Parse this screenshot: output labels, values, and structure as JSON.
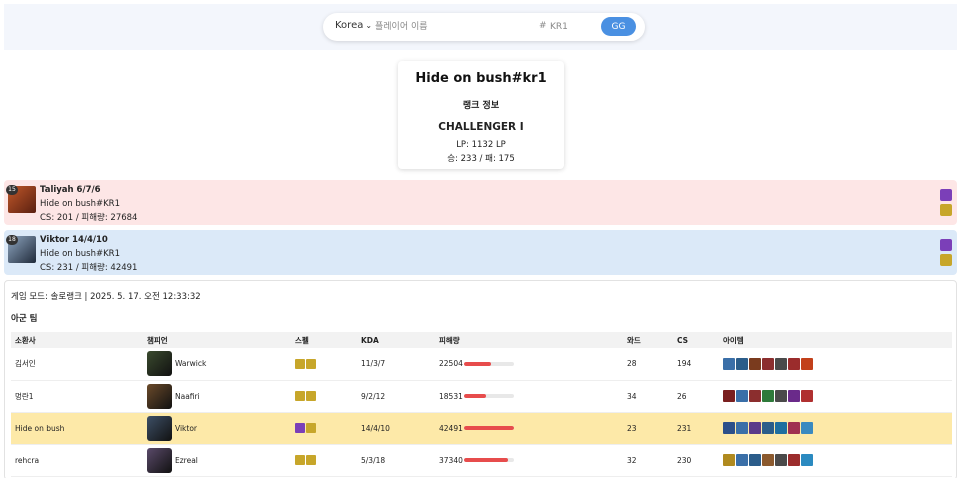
{
  "search": {
    "region": "Korea",
    "name_placeholder": "플레이어 이름",
    "hash": "#",
    "tag_placeholder": "KR1",
    "button": "GG"
  },
  "profile": {
    "name": "Hide on bush#kr1",
    "title": "랭크 정보",
    "tier": "CHALLENGER I",
    "lp": "LP: 1132 LP",
    "winloss": "승: 233 / 패: 175"
  },
  "matches": [
    {
      "result": "loss",
      "level": "15",
      "champion_kda": "Taliyah 6/7/6",
      "player": "Hide on bush#KR1",
      "stats": "CS: 201 / 피해량: 27684",
      "champ_color": "#8a3a1f",
      "spell_colors": [
        "#7b3fb8",
        "#c7a62a"
      ]
    },
    {
      "result": "win",
      "level": "18",
      "champion_kda": "Viktor 14/4/10",
      "player": "Hide on bush#KR1",
      "stats": "CS: 231 / 피해량: 42491",
      "champ_color": "#3d4f66",
      "spell_colors": [
        "#7b3fb8",
        "#c7a62a"
      ]
    }
  ],
  "detail": {
    "meta": "게임 모드: 솔로랭크 | 2025. 5. 17. 오전 12:33:32",
    "team_label": "아군 팀",
    "headers": [
      "소환사",
      "챔피언",
      "스펠",
      "KDA",
      "피해량",
      "와드",
      "CS",
      "아이템"
    ],
    "players": [
      {
        "summoner": "김서인",
        "champion": "Warwick",
        "kda": "11/3/7",
        "damage": "22504",
        "damage_ratio": 0.53,
        "wards": "28",
        "cs": "194",
        "champ_color": "#3a4a2e",
        "spell_colors": [
          "#c7a62a",
          "#c7a62a"
        ],
        "item_colors": [
          "#3a6fa8",
          "#2b5d8a",
          "#7a3b1e",
          "#8b2e2e",
          "#4a4a4a",
          "#9b2c2c",
          "#c2401a"
        ],
        "highlight": false
      },
      {
        "summoner": "멍란1",
        "champion": "Naafiri",
        "kda": "9/2/12",
        "damage": "18531",
        "damage_ratio": 0.44,
        "wards": "34",
        "cs": "26",
        "champ_color": "#6b4a2a",
        "spell_colors": [
          "#c7a62a",
          "#c7a62a"
        ],
        "item_colors": [
          "#7a1f1f",
          "#3a6fa8",
          "#8b2e2e",
          "#2e7a3a",
          "#4a4a4a",
          "#6a2a8a",
          "#b03030"
        ],
        "highlight": false
      },
      {
        "summoner": "Hide on bush",
        "champion": "Viktor",
        "kda": "14/4/10",
        "damage": "42491",
        "damage_ratio": 1.0,
        "wards": "23",
        "cs": "231",
        "champ_color": "#3d4f66",
        "spell_colors": [
          "#7b3fb8",
          "#c7a62a"
        ],
        "item_colors": [
          "#2b4f8a",
          "#3a6fa8",
          "#5a3a8a",
          "#2b5d8a",
          "#1f6fa0",
          "#a03050",
          "#3a8ac0"
        ],
        "highlight": true
      },
      {
        "summoner": "rehcra",
        "champion": "Ezreal",
        "kda": "5/3/18",
        "damage": "37340",
        "damage_ratio": 0.88,
        "wards": "32",
        "cs": "230",
        "champ_color": "#5a4a6a",
        "spell_colors": [
          "#c7a62a",
          "#c7a62a"
        ],
        "item_colors": [
          "#b08a1f",
          "#3a6fa8",
          "#2b5d8a",
          "#8b5a2e",
          "#4a4a4a",
          "#9b2c2c",
          "#2b8ac0"
        ],
        "highlight": false
      }
    ]
  }
}
